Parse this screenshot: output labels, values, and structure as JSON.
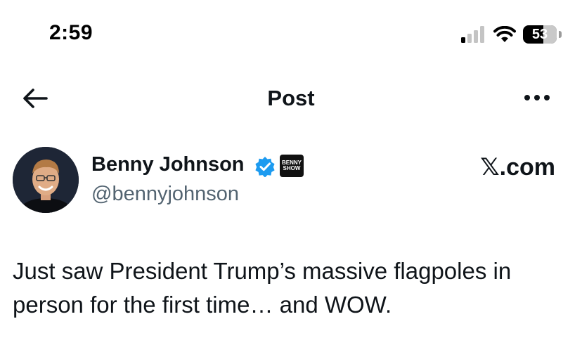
{
  "status_bar": {
    "time": "2:59",
    "battery_level": "53",
    "icons": [
      "cellular-signal-icon",
      "wifi-icon",
      "battery-icon"
    ]
  },
  "nav": {
    "back_icon": "arrow-left-icon",
    "title": "Post",
    "more_icon": "more-horizontal-icon"
  },
  "post": {
    "author_name": "Benny Johnson",
    "handle": "@bennyjohnson",
    "verified_color": "#1d9bf0",
    "affiliate_badge": [
      "BENNY",
      "SHOW"
    ],
    "watermark": "𝕏.com",
    "text": "Just saw President Trump’s massive flagpoles in person for the first time… and WOW."
  }
}
